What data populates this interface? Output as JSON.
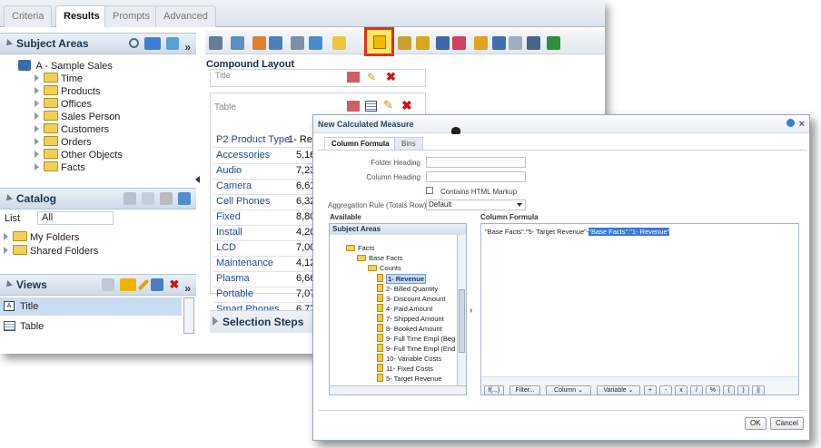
{
  "tabs": [
    "Criteria",
    "Results",
    "Prompts",
    "Advanced"
  ],
  "active_tab": "Results",
  "subject_areas": {
    "title": "Subject Areas",
    "root": "A - Sample Sales",
    "folders": [
      "Time",
      "Products",
      "Offices",
      "Sales Person",
      "Customers",
      "Orders",
      "Other Objects",
      "Facts"
    ]
  },
  "catalog": {
    "title": "Catalog",
    "list_label": "List",
    "list_value": "All",
    "folders": [
      "My Folders",
      "Shared Folders"
    ]
  },
  "views": {
    "title": "Views",
    "items": [
      "Title",
      "Table"
    ]
  },
  "layout": {
    "title": "Compound Layout",
    "title_section": "Title",
    "table_section": "Table",
    "header": [
      "P2 Product Type",
      "1- Re"
    ],
    "rows": [
      [
        "Accessories",
        "5,16"
      ],
      [
        "Audio",
        "7,23"
      ],
      [
        "Camera",
        "6,61"
      ],
      [
        "Cell Phones",
        "6,32"
      ],
      [
        "Fixed",
        "8,80"
      ],
      [
        "Install",
        "4,20"
      ],
      [
        "LCD",
        "7,00"
      ],
      [
        "Maintenance",
        "4,12"
      ],
      [
        "Plasma",
        "6,66"
      ],
      [
        "Portable",
        "7,07"
      ],
      [
        "Smart Phones",
        "6,77"
      ]
    ],
    "selection_steps": "Selection Steps"
  },
  "dialog": {
    "title": "New Calculated Measure",
    "tabs": [
      "Column Formula",
      "Bins"
    ],
    "folder_heading": "Folder Heading",
    "column_heading": "Column Heading",
    "html_markup": "Contains HTML Markup",
    "aggregation_label": "Aggregation Rule (Totals Row)",
    "aggregation_value": "Default",
    "available": "Available",
    "column_formula": "Column Formula",
    "subject_areas": "Subject Areas",
    "tree": [
      "Facts",
      "Base Facts",
      "Counts",
      "1- Revenue",
      "2- Billed Quantity",
      "3- Discount Amount",
      "4- Paid Amount",
      "7- Shipped Amount",
      "8- Booked Amount",
      "9- Full Time Empl (Beg",
      "9- Full Time Empl (End",
      "10- Variable Costs",
      "11- Fixed Costs",
      "5- Target Revenue"
    ],
    "formula_plain": "\"Base Facts\".\"5- Target Revenue\"-",
    "formula_selected": "\"Base Facts\".\"1- Revenue\"",
    "buttons": [
      "f(...)",
      "Filter...",
      "Column ⌄",
      "Variable ⌄",
      "+",
      "-",
      "x",
      "/",
      "%",
      "(",
      ")",
      "||"
    ],
    "ok": "OK",
    "cancel": "Cancel"
  },
  "colors": {
    "accent": "#1e4a99",
    "highlight": "#e83010"
  }
}
